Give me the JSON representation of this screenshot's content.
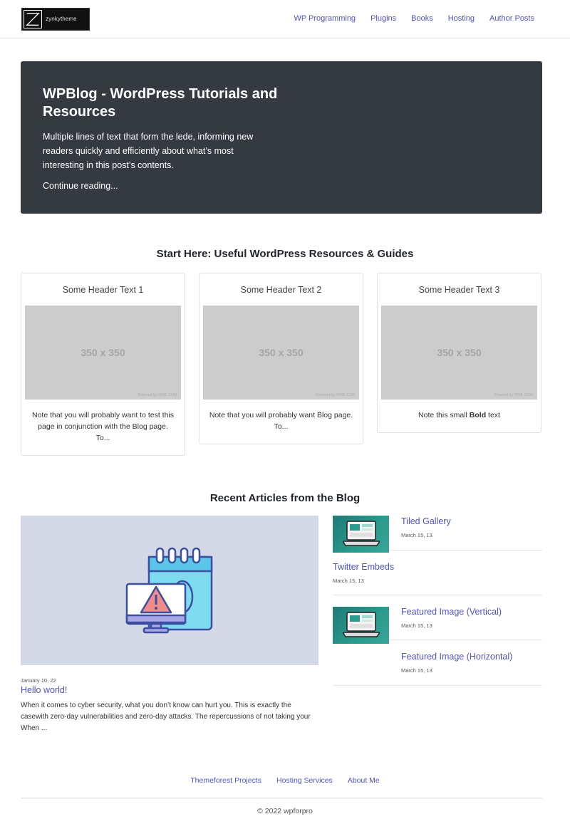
{
  "header": {
    "logo_text": "zynkytheme",
    "nav": [
      "WP Programming",
      "Plugins",
      "Books",
      "Hosting",
      "Author Posts"
    ]
  },
  "hero": {
    "title": "WPBlog - WordPress Tutorials and Resources",
    "lede": "Multiple lines of text that form the lede, informing new readers quickly and efficiently about what’s most interesting in this post’s contents.",
    "link": "Continue reading..."
  },
  "resources": {
    "title": "Start Here: Useful WordPress Resources & Guides",
    "cards": [
      {
        "header": "Some Header Text 1",
        "image_label": "350 x 350",
        "image_credit": "Powered by HTML.COM",
        "text": "Note that you will probably want to test this page in conjunction with the Blog page. To..."
      },
      {
        "header": "Some Header Text 2",
        "image_label": "350 x 350",
        "image_credit": "Powered by HTML.COM",
        "text": "Note that you will probably want Blog page. To..."
      },
      {
        "header": "Some Header Text 3",
        "image_label": "350 x 350",
        "image_credit": "Powered by HTML.COM",
        "text_before": "Note this small ",
        "text_bold": "Bold",
        "text_after": " text"
      }
    ]
  },
  "blog": {
    "title": "Recent Articles from the Blog",
    "featured": {
      "date": "January 10, 22",
      "title": "Hello world!",
      "excerpt": "When it comes to cyber security, what you don’t know can hurt you. This is exactly the casewith zero-day vulnerabilities and zero-day attacks. The repercussions of not taking your When ..."
    },
    "side_posts": [
      {
        "title": "Tiled Gallery",
        "date": "March 15, 13",
        "has_thumb": true
      },
      {
        "title": "Twitter Embeds",
        "date": "March 15, 13",
        "has_thumb": false
      },
      {
        "title": "Featured Image (Vertical)",
        "date": "March 15, 13",
        "has_thumb": true
      },
      {
        "title": "Featured Image (Horizontal)",
        "date": "March 15, 13",
        "has_thumb": false
      }
    ]
  },
  "footer": {
    "links": [
      "Themeforest Projects",
      "Hosting Services",
      "About Me"
    ],
    "copyright": "© 2022 wpforpro"
  },
  "colors": {
    "link": "#4f53c8",
    "hero_bg": "#343a40",
    "placeholder_bg": "#cccccc",
    "featured_bg": "#d4d9e8"
  }
}
